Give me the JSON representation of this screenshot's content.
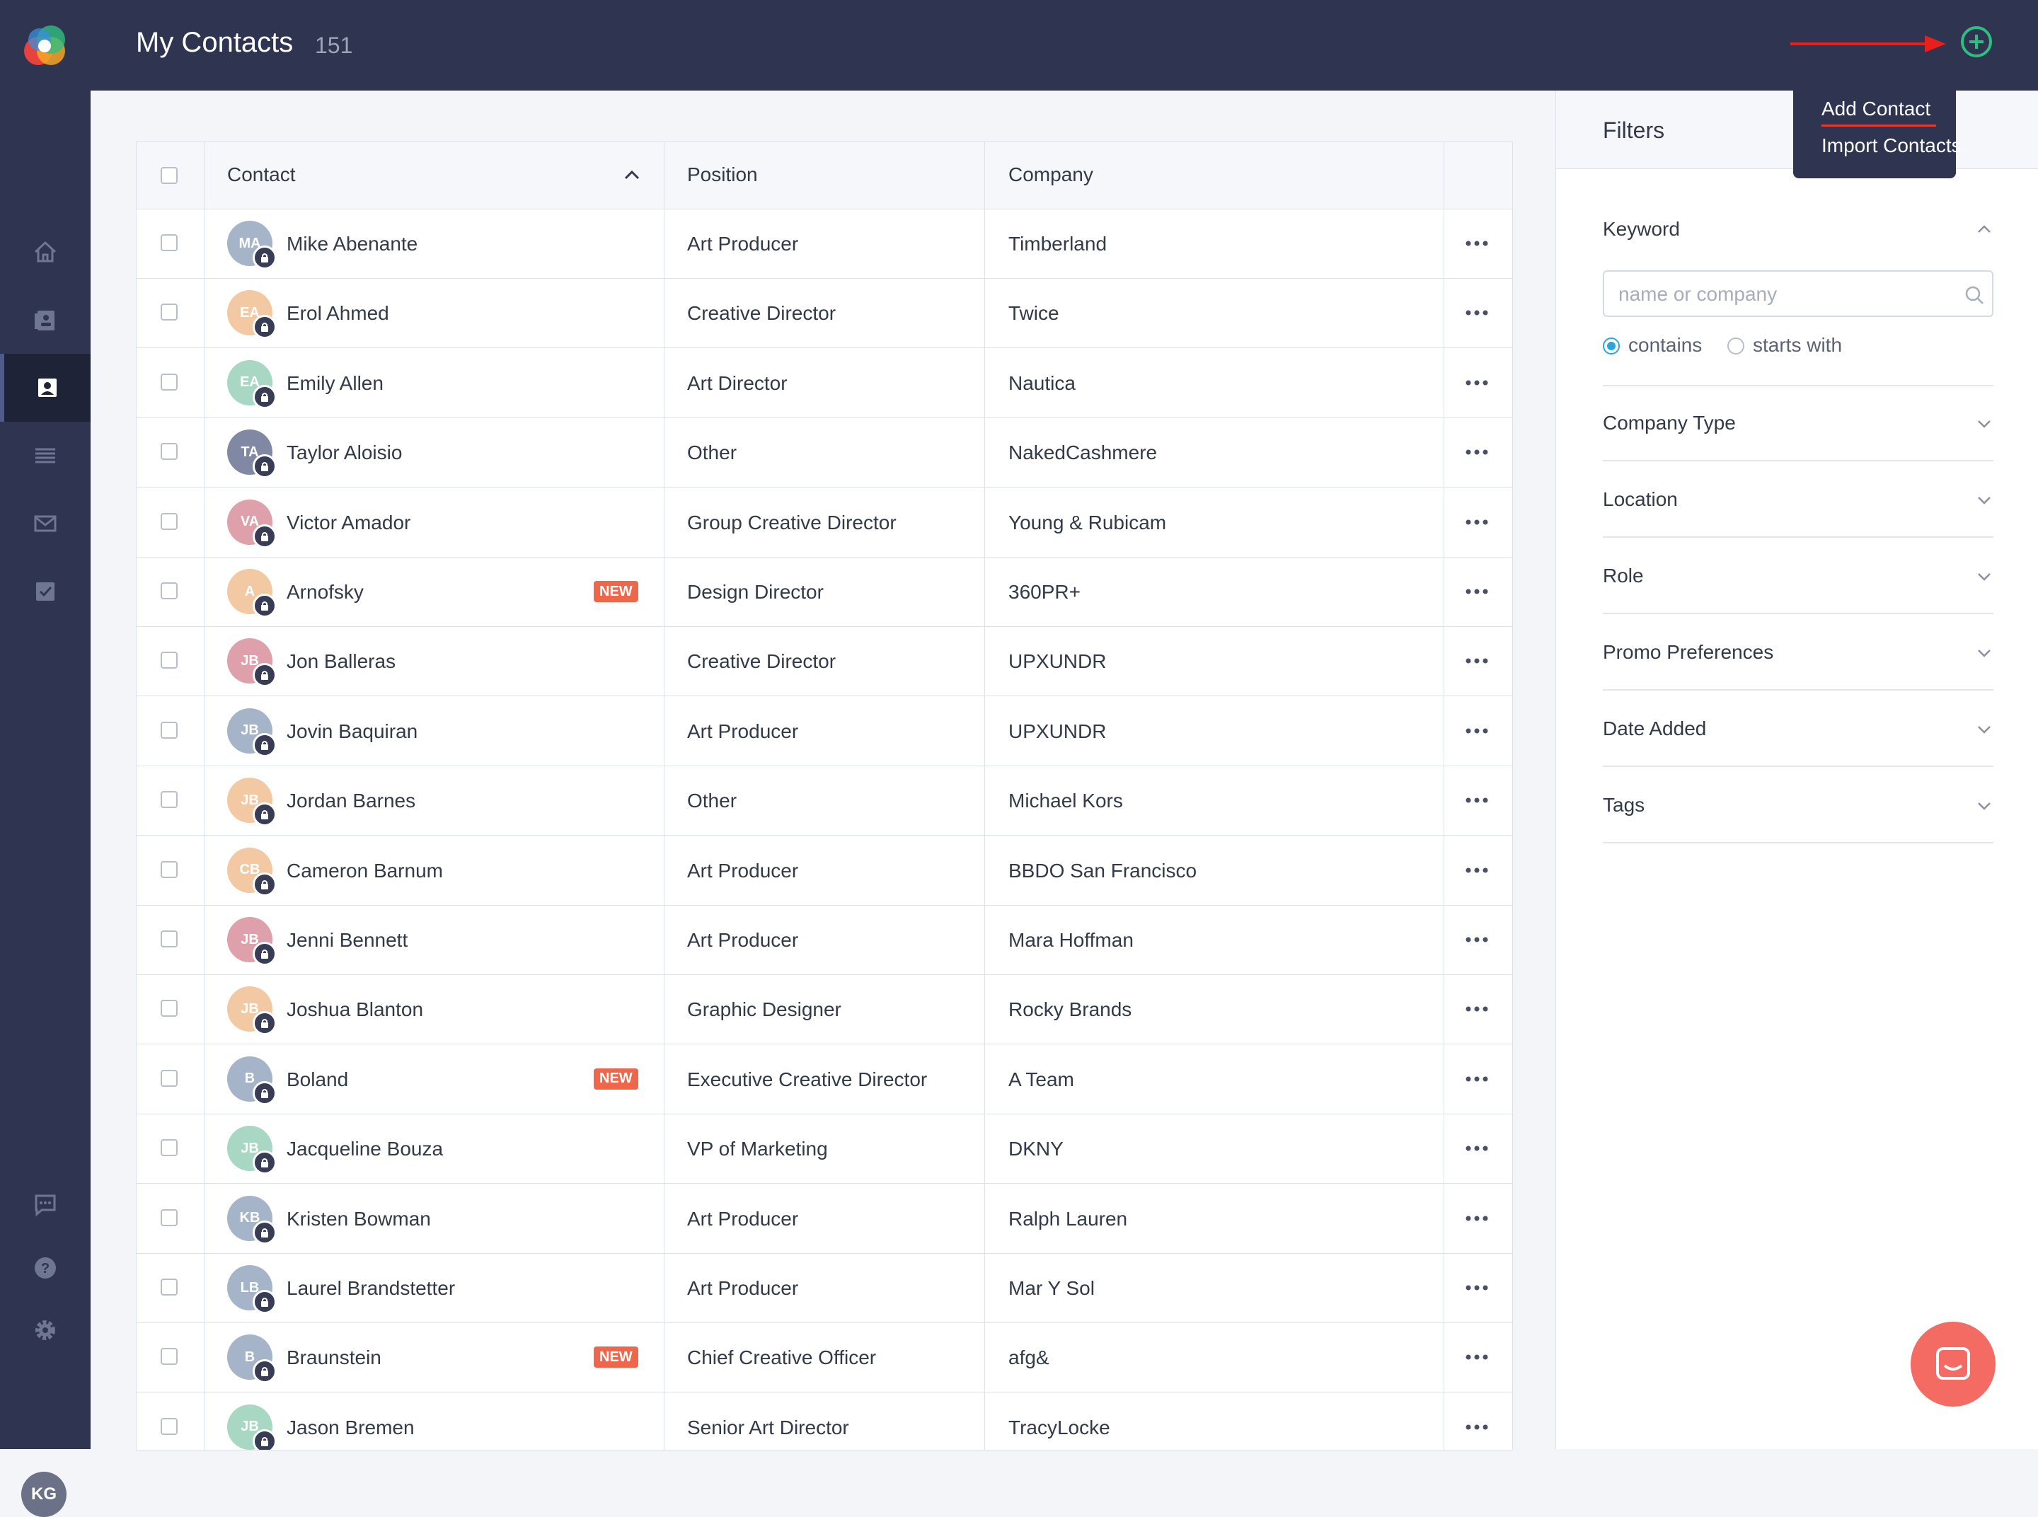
{
  "header": {
    "title": "My Contacts",
    "count": "151"
  },
  "user": {
    "initials": "KG"
  },
  "menu": {
    "add": "Add Contact",
    "import": "Import Contacts"
  },
  "table": {
    "headers": {
      "contact": "Contact",
      "position": "Position",
      "company": "Company"
    },
    "rows": [
      {
        "initials": "MA",
        "name": "Mike Abenante",
        "badge": "",
        "position": "Art Producer",
        "company": "Timberland",
        "color": "#a5b4c8"
      },
      {
        "initials": "EA",
        "name": "Erol Ahmed",
        "badge": "",
        "position": "Creative Director",
        "company": "Twice",
        "color": "#f3c9a3"
      },
      {
        "initials": "EA",
        "name": "Emily Allen",
        "badge": "",
        "position": "Art Director",
        "company": "Nautica",
        "color": "#a8d8c4"
      },
      {
        "initials": "TA",
        "name": "Taylor Aloisio",
        "badge": "",
        "position": "Other",
        "company": "NakedCashmere",
        "color": "#8188a4"
      },
      {
        "initials": "VA",
        "name": "Victor Amador",
        "badge": "",
        "position": "Group Creative Director",
        "company": "Young & Rubicam",
        "color": "#dea0ab"
      },
      {
        "initials": "A",
        "name": "Arnofsky",
        "badge": "NEW",
        "position": "Design Director",
        "company": "360PR+",
        "color": "#f3c9a3"
      },
      {
        "initials": "JB",
        "name": "Jon Balleras",
        "badge": "",
        "position": "Creative Director",
        "company": "UPXUNDR",
        "color": "#dea0ab"
      },
      {
        "initials": "JB",
        "name": "Jovin Baquiran",
        "badge": "",
        "position": "Art Producer",
        "company": "UPXUNDR",
        "color": "#a5b4c8"
      },
      {
        "initials": "JB",
        "name": "Jordan Barnes",
        "badge": "",
        "position": "Other",
        "company": "Michael Kors",
        "color": "#f3c9a3"
      },
      {
        "initials": "CB",
        "name": "Cameron Barnum",
        "badge": "",
        "position": "Art Producer",
        "company": "BBDO San Francisco",
        "color": "#f3c9a3"
      },
      {
        "initials": "JB",
        "name": "Jenni Bennett",
        "badge": "",
        "position": "Art Producer",
        "company": "Mara Hoffman",
        "color": "#dea0ab"
      },
      {
        "initials": "JB",
        "name": "Joshua Blanton",
        "badge": "",
        "position": "Graphic Designer",
        "company": "Rocky Brands",
        "color": "#f3c9a3"
      },
      {
        "initials": "B",
        "name": "Boland",
        "badge": "NEW",
        "position": "Executive Creative Director",
        "company": "A Team",
        "color": "#a5b4c8"
      },
      {
        "initials": "JB",
        "name": "Jacqueline Bouza",
        "badge": "",
        "position": "VP of Marketing",
        "company": "DKNY",
        "color": "#a8d8c4"
      },
      {
        "initials": "KB",
        "name": "Kristen Bowman",
        "badge": "",
        "position": "Art Producer",
        "company": "Ralph Lauren",
        "color": "#a5b4c8"
      },
      {
        "initials": "LB",
        "name": "Laurel Brandstetter",
        "badge": "",
        "position": "Art Producer",
        "company": "Mar Y Sol",
        "color": "#a5b4c8"
      },
      {
        "initials": "B",
        "name": "Braunstein",
        "badge": "NEW",
        "position": "Chief Creative Officer",
        "company": "afg&",
        "color": "#a5b4c8"
      },
      {
        "initials": "JB",
        "name": "Jason Bremen",
        "badge": "",
        "position": "Senior Art Director",
        "company": "TracyLocke",
        "color": "#a8d8c4"
      }
    ]
  },
  "filters": {
    "title": "Filters",
    "keyword": {
      "label": "Keyword",
      "placeholder": "name or company",
      "options": [
        "contains",
        "starts with"
      ],
      "selected": "contains"
    },
    "sections": [
      "Company Type",
      "Location",
      "Role",
      "Promo Preferences",
      "Date Added",
      "Tags"
    ]
  },
  "colors": {
    "topbar": "#2f3451",
    "accent": "#2aa7d8",
    "add": "#2dbf7f",
    "badge": "#f0664b",
    "fab": "#f36b62"
  },
  "icons": {
    "sidebar": [
      "home-icon",
      "contacts-card-icon",
      "person-icon",
      "list-icon",
      "mail-icon",
      "checkbox-icon",
      "feedback-icon",
      "help-icon",
      "settings-icon"
    ],
    "add": "plus-circle-icon",
    "lock": "lock-icon",
    "more": "ellipsis-icon",
    "search": "search-icon",
    "chat": "chat-icon"
  }
}
